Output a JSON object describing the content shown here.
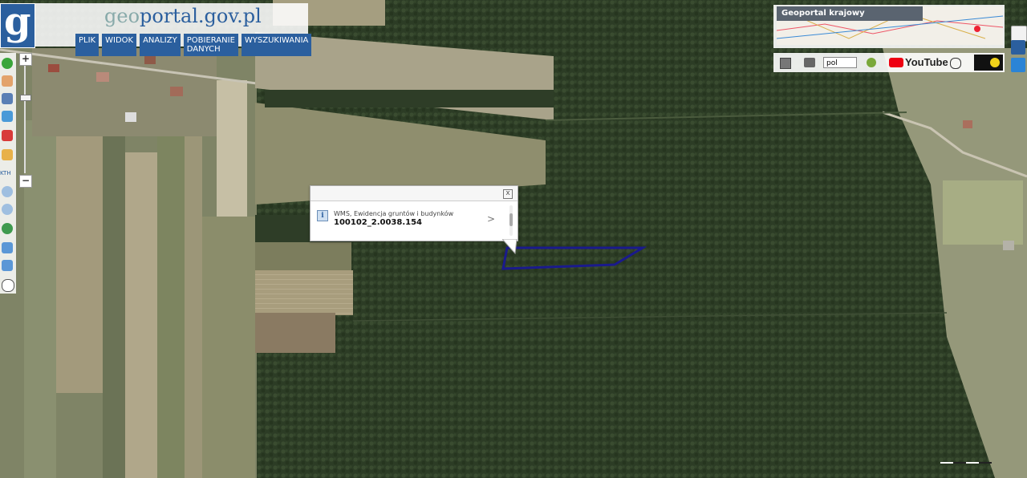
{
  "header": {
    "logo_letter": "g",
    "brand_prefix": "geo",
    "brand_rest": "portal.gov.pl",
    "menu": [
      "PLIK",
      "WIDOK",
      "ANALIZY",
      "POBIERANIE DANYCH",
      "WYSZUKIWANIA"
    ]
  },
  "minimap": {
    "title": "Geoportal krajowy"
  },
  "toolbar_right": {
    "language": "pol",
    "youtube_label": "YouTube"
  },
  "left_tools": {
    "zoom_in": "+",
    "zoom_out": "−",
    "icons": [
      "info-icon",
      "hand-pan-icon",
      "layers-list-icon",
      "layer-add-icon",
      "layer-remove-icon",
      "pencil-icon",
      "measure-icon",
      "zoom-in-icon",
      "zoom-out-icon",
      "globe-icon",
      "back-arrow-icon",
      "forward-arrow-icon",
      "crosshair-icon"
    ],
    "measure_label": "KTH"
  },
  "popup": {
    "line1": "WMS, Ewidencja gruntów i budynków",
    "line2": "100102_2.0038.154",
    "close": "x",
    "more": ">"
  },
  "colors": {
    "brand_blue": "#2b5f9e",
    "parcel_outline": "#1a1a8c",
    "forest": "#2d3d26"
  }
}
